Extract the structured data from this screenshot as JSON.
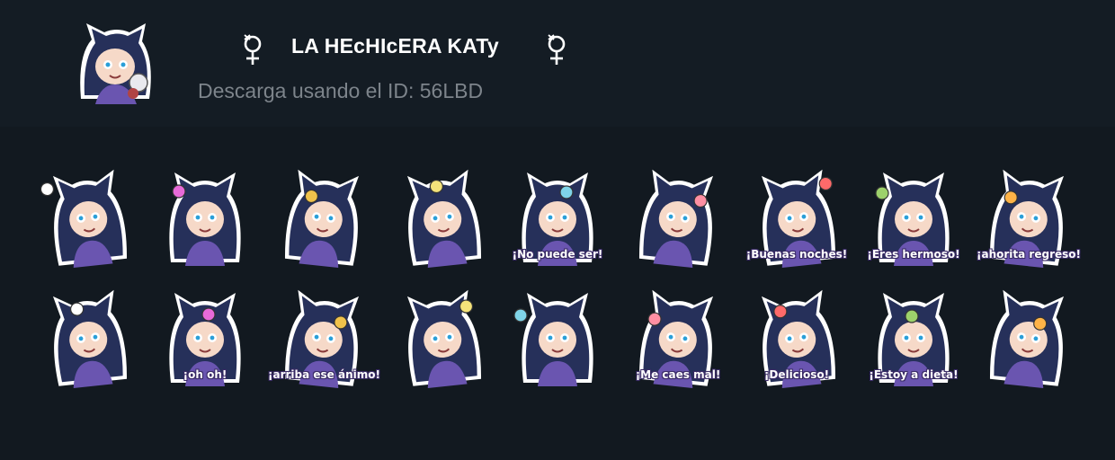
{
  "pack": {
    "title": "LA HEcHIcERA KATy",
    "subtitle": "Descarga usando el ID: 56LBD",
    "title_icon": "venus-symbol-icon",
    "accent": "#ffffff",
    "muted": "#7d848b"
  },
  "stickers": [
    {
      "icon": "question-sticker",
      "caption": ""
    },
    {
      "icon": "sword-sticker",
      "caption": ""
    },
    {
      "icon": "scared-sticker",
      "caption": ""
    },
    {
      "icon": "heart-hands-sticker",
      "caption": ""
    },
    {
      "icon": "angry-sticker",
      "caption": "¡No puede ser!"
    },
    {
      "icon": "ukulele-sticker",
      "caption": ""
    },
    {
      "icon": "moon-sleep-sticker",
      "caption": "¡Buenas noches!"
    },
    {
      "icon": "blush-sticker",
      "caption": "¡Eres hermoso!"
    },
    {
      "icon": "broom-flying-sticker",
      "caption": "¡ahorita regreso!"
    },
    {
      "icon": "swimming-sticker",
      "caption": ""
    },
    {
      "icon": "oh-oh-sticker",
      "caption": "¡oh oh!"
    },
    {
      "icon": "pompoms-sticker",
      "caption": "¡arriba ese ánimo!"
    },
    {
      "icon": "shocked-sticker",
      "caption": ""
    },
    {
      "icon": "chef-cooking-sticker",
      "caption": ""
    },
    {
      "icon": "grumpy-sticker",
      "caption": "¡Me caes mal!"
    },
    {
      "icon": "delicious-sticker",
      "caption": "¡Delicioso!"
    },
    {
      "icon": "diet-crying-sticker",
      "caption": "¡Estoy a dieta!"
    },
    {
      "icon": "sweeping-sticker",
      "caption": ""
    }
  ],
  "colors": {
    "background": "#121920",
    "header": "#141c24",
    "hair": "#26305a",
    "skin": "#f6d9c8",
    "shirt": "#6a55b0"
  }
}
